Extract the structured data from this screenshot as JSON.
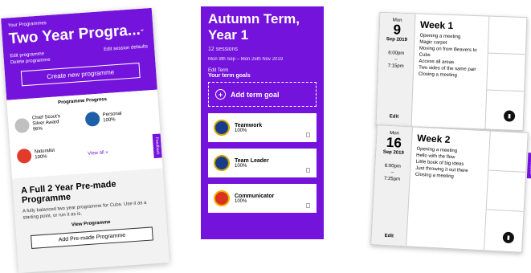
{
  "programme": {
    "label": "Your Programmes",
    "title": "Two Year Progra...",
    "edit_programme": "Edit programme",
    "delete_programme": "Delete programme",
    "edit_session_defaults": "Edit session defaults",
    "create_button": "Create new programme",
    "progress_title": "Programme Progress",
    "badges": [
      {
        "name_line1": "Chief Scout's",
        "name_line2": "Silver Award",
        "pct": "96%",
        "color": "#c0c0c0"
      },
      {
        "name_line1": "Personal",
        "name_line2": "",
        "pct": "100%",
        "color": "#1d5fa8"
      },
      {
        "name_line1": "Naturalist",
        "name_line2": "",
        "pct": "100%",
        "color": "#e23b2c"
      }
    ],
    "view_all": "View all »",
    "feedback": "Feedback",
    "premade_title": "A Full 2 Year Pre-made Programme",
    "premade_desc": "A fully balanced two year programme for Cubs. Use it as a starting point, or run it as is.",
    "view_programme": "View Programme",
    "add_premade": "Add Pre-made Programme"
  },
  "term": {
    "title_line1": "Autumn Term,",
    "title_line2": "Year 1",
    "sessions": "12 sessions",
    "dates": "Mon 9th Sep – Mon 25th Nov 2019",
    "edit_term": "Edit Term",
    "your_goals": "Your term goals",
    "add_goal": "Add term goal",
    "goals": [
      {
        "name": "Teamwork",
        "pct": "100%",
        "color": "#163c8a"
      },
      {
        "name": "Team Leader",
        "pct": "100%",
        "color": "#163c8a"
      },
      {
        "name": "Communicator",
        "pct": "100%",
        "color": "#d9321f"
      }
    ]
  },
  "weeks": [
    {
      "mon": "Mon",
      "day": "9",
      "month": "Sep 2019",
      "start": "6:00pm",
      "dash": "–",
      "end": "7:15pm",
      "edit": "Edit",
      "title": "Week 1",
      "activities": [
        "Opening a meeting",
        "Magic carpet",
        "Moving on from Beavers to Cubs",
        "Access all areas",
        "Two sides of the same pair",
        "Closing a meeting"
      ]
    },
    {
      "mon": "Mon",
      "day": "16",
      "month": "Sep 2019",
      "start": "6:00pm",
      "dash": "–",
      "end": "7:25pm",
      "edit": "Edit",
      "title": "Week 2",
      "activities": [
        "Opening a meeting",
        "Hello with the flow",
        "Little book of big ideas",
        "Just throwing it out there",
        "Closing a meeting"
      ]
    }
  ]
}
